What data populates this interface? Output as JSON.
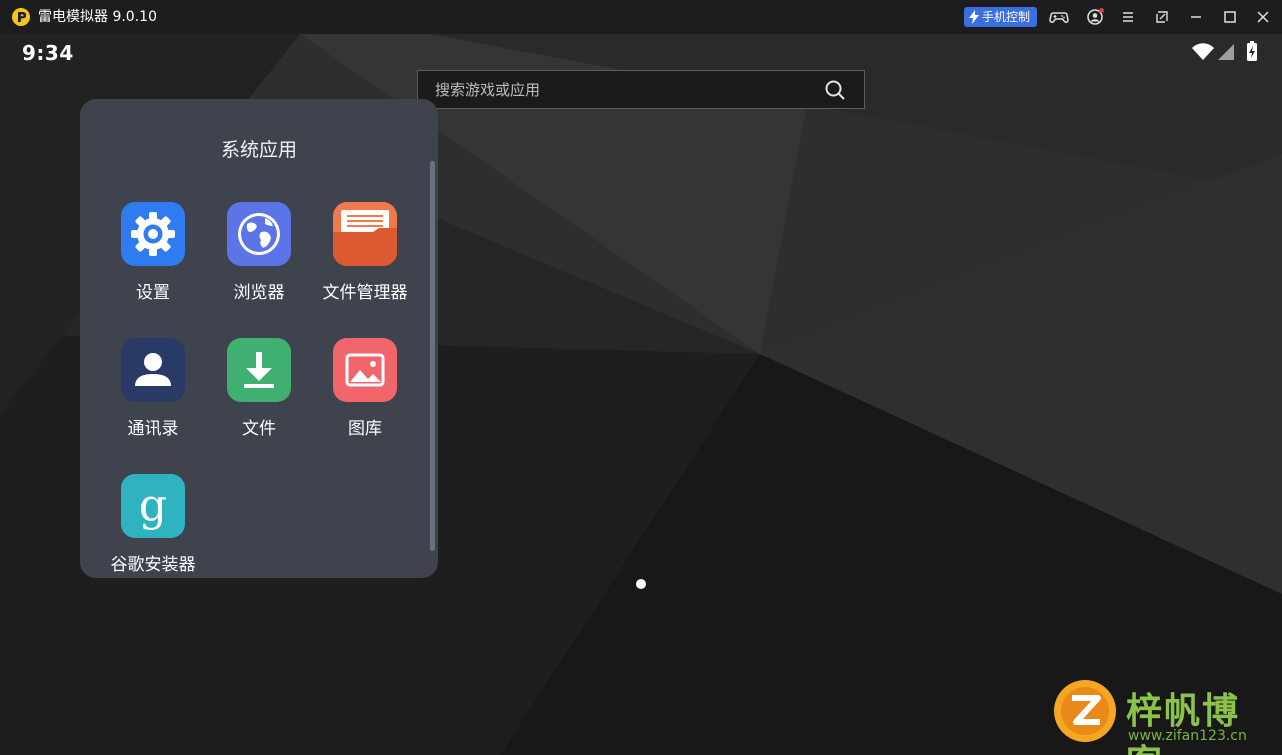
{
  "titlebar": {
    "app_title": "雷电模拟器 9.0.10",
    "phone_control_label": "手机控制",
    "icons": [
      "gamepad-icon",
      "account-icon",
      "menu-icon",
      "popout-icon",
      "minimize-icon",
      "maximize-icon",
      "close-icon"
    ]
  },
  "statusbar": {
    "time": "9:34",
    "icons": [
      "wifi-icon",
      "signal-icon",
      "battery-charging-icon"
    ]
  },
  "search": {
    "placeholder": "搜索游戏或应用"
  },
  "folder": {
    "title": "系统应用",
    "apps": [
      {
        "label": "设置",
        "icon": "settings-gear-icon",
        "color": "#2f7cf0"
      },
      {
        "label": "浏览器",
        "icon": "globe-icon",
        "color": "#5b74e8"
      },
      {
        "label": "文件管理器",
        "icon": "folder-file-icon",
        "color": "#e8683c"
      },
      {
        "label": "通讯录",
        "icon": "contact-person-icon",
        "color": "#2a3a66"
      },
      {
        "label": "文件",
        "icon": "download-icon",
        "color": "#3fb070"
      },
      {
        "label": "图库",
        "icon": "image-gallery-icon",
        "color": "#f0666a"
      },
      {
        "label": "谷歌安装器",
        "icon": "google-g-icon",
        "color": "#2fb3c0"
      }
    ]
  },
  "watermark": {
    "text": "梓帆博客",
    "url": "www.zifan123.cn"
  },
  "colors": {
    "titlebar_bg": "#1d1d1f",
    "accent": "#3b6fe0",
    "folder_bg": "#404450"
  }
}
